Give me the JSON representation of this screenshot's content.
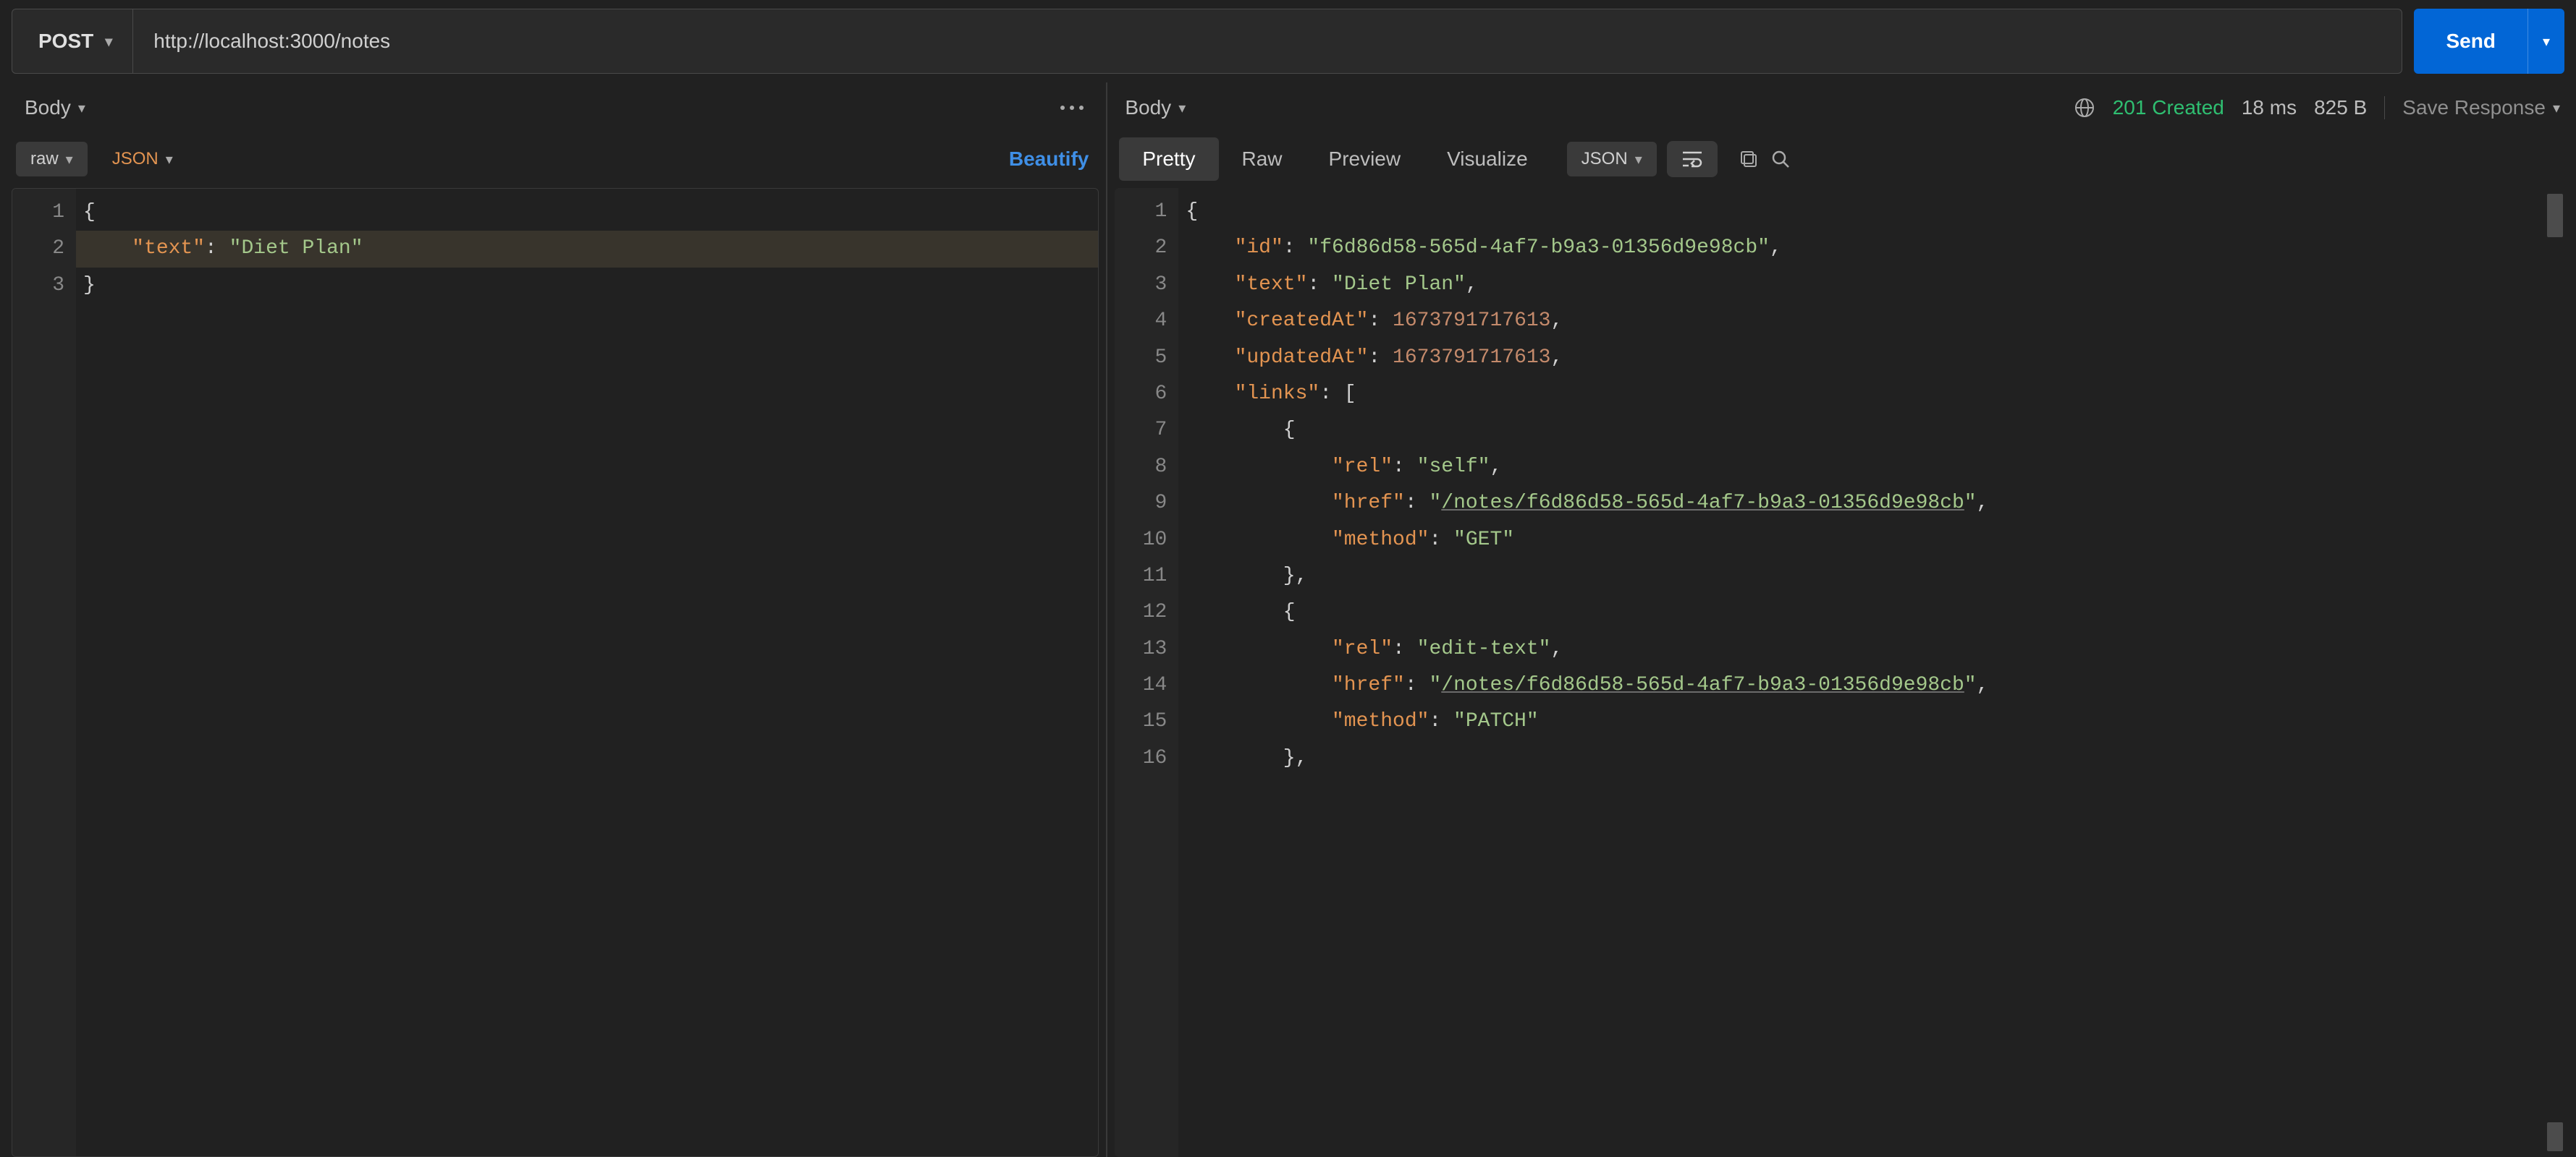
{
  "request": {
    "method": "POST",
    "url": "http://localhost:3000/notes",
    "send_label": "Send",
    "body_tab": "Body",
    "raw_label": "raw",
    "format_label": "JSON",
    "beautify": "Beautify",
    "body_lines": [
      "{",
      "    \"text\": \"Diet Plan\"",
      "}"
    ],
    "body_tokens": [
      [
        {
          "t": "{",
          "c": "p"
        }
      ],
      [
        {
          "t": "    ",
          "c": "p"
        },
        {
          "t": "\"text\"",
          "c": "k"
        },
        {
          "t": ":",
          "c": "p"
        },
        {
          "t": " ",
          "c": "p"
        },
        {
          "t": "\"Diet Plan\"",
          "c": "s"
        }
      ],
      [
        {
          "t": "}",
          "c": "p"
        }
      ]
    ]
  },
  "response": {
    "body_tab": "Body",
    "tabs": {
      "pretty": "Pretty",
      "raw": "Raw",
      "preview": "Preview",
      "visualize": "Visualize"
    },
    "format_label": "JSON",
    "status": "201 Created",
    "time": "18 ms",
    "size": "825 B",
    "save_label": "Save Response",
    "body_tokens": [
      [
        {
          "t": "{",
          "c": "p"
        }
      ],
      [
        {
          "t": "    ",
          "c": "p"
        },
        {
          "t": "\"id\"",
          "c": "k"
        },
        {
          "t": ":",
          "c": "p"
        },
        {
          "t": " ",
          "c": "p"
        },
        {
          "t": "\"f6d86d58-565d-4af7-b9a3-01356d9e98cb\"",
          "c": "s"
        },
        {
          "t": ",",
          "c": "p"
        }
      ],
      [
        {
          "t": "    ",
          "c": "p"
        },
        {
          "t": "\"text\"",
          "c": "k"
        },
        {
          "t": ":",
          "c": "p"
        },
        {
          "t": " ",
          "c": "p"
        },
        {
          "t": "\"Diet Plan\"",
          "c": "s"
        },
        {
          "t": ",",
          "c": "p"
        }
      ],
      [
        {
          "t": "    ",
          "c": "p"
        },
        {
          "t": "\"createdAt\"",
          "c": "k"
        },
        {
          "t": ":",
          "c": "p"
        },
        {
          "t": " ",
          "c": "p"
        },
        {
          "t": "1673791717613",
          "c": "n"
        },
        {
          "t": ",",
          "c": "p"
        }
      ],
      [
        {
          "t": "    ",
          "c": "p"
        },
        {
          "t": "\"updatedAt\"",
          "c": "k"
        },
        {
          "t": ":",
          "c": "p"
        },
        {
          "t": " ",
          "c": "p"
        },
        {
          "t": "1673791717613",
          "c": "n"
        },
        {
          "t": ",",
          "c": "p"
        }
      ],
      [
        {
          "t": "    ",
          "c": "p"
        },
        {
          "t": "\"links\"",
          "c": "k"
        },
        {
          "t": ":",
          "c": "p"
        },
        {
          "t": " ",
          "c": "p"
        },
        {
          "t": "[",
          "c": "p"
        }
      ],
      [
        {
          "t": "        ",
          "c": "p"
        },
        {
          "t": "{",
          "c": "p"
        }
      ],
      [
        {
          "t": "            ",
          "c": "p"
        },
        {
          "t": "\"rel\"",
          "c": "k"
        },
        {
          "t": ":",
          "c": "p"
        },
        {
          "t": " ",
          "c": "p"
        },
        {
          "t": "\"self\"",
          "c": "s"
        },
        {
          "t": ",",
          "c": "p"
        }
      ],
      [
        {
          "t": "            ",
          "c": "p"
        },
        {
          "t": "\"href\"",
          "c": "k"
        },
        {
          "t": ":",
          "c": "p"
        },
        {
          "t": " ",
          "c": "p"
        },
        {
          "t": "\"",
          "c": "s"
        },
        {
          "t": "/notes/f6d86d58-565d-4af7-b9a3-01356d9e98cb",
          "c": "s link"
        },
        {
          "t": "\"",
          "c": "s"
        },
        {
          "t": ",",
          "c": "p"
        }
      ],
      [
        {
          "t": "            ",
          "c": "p"
        },
        {
          "t": "\"method\"",
          "c": "k"
        },
        {
          "t": ":",
          "c": "p"
        },
        {
          "t": " ",
          "c": "p"
        },
        {
          "t": "\"GET\"",
          "c": "s"
        }
      ],
      [
        {
          "t": "        ",
          "c": "p"
        },
        {
          "t": "}",
          "c": "p"
        },
        {
          "t": ",",
          "c": "p"
        }
      ],
      [
        {
          "t": "        ",
          "c": "p"
        },
        {
          "t": "{",
          "c": "p"
        }
      ],
      [
        {
          "t": "            ",
          "c": "p"
        },
        {
          "t": "\"rel\"",
          "c": "k"
        },
        {
          "t": ":",
          "c": "p"
        },
        {
          "t": " ",
          "c": "p"
        },
        {
          "t": "\"edit-text\"",
          "c": "s"
        },
        {
          "t": ",",
          "c": "p"
        }
      ],
      [
        {
          "t": "            ",
          "c": "p"
        },
        {
          "t": "\"href\"",
          "c": "k"
        },
        {
          "t": ":",
          "c": "p"
        },
        {
          "t": " ",
          "c": "p"
        },
        {
          "t": "\"",
          "c": "s"
        },
        {
          "t": "/notes/f6d86d58-565d-4af7-b9a3-01356d9e98cb",
          "c": "s link"
        },
        {
          "t": "\"",
          "c": "s"
        },
        {
          "t": ",",
          "c": "p"
        }
      ],
      [
        {
          "t": "            ",
          "c": "p"
        },
        {
          "t": "\"method\"",
          "c": "k"
        },
        {
          "t": ":",
          "c": "p"
        },
        {
          "t": " ",
          "c": "p"
        },
        {
          "t": "\"PATCH\"",
          "c": "s"
        }
      ],
      [
        {
          "t": "        ",
          "c": "p"
        },
        {
          "t": "}",
          "c": "p"
        },
        {
          "t": ",",
          "c": "p"
        }
      ]
    ]
  },
  "colors": {
    "accent": "#0266d6",
    "success": "#2fbf71",
    "key": "#e39451",
    "string": "#a4c88b",
    "number": "#c48a6b"
  }
}
